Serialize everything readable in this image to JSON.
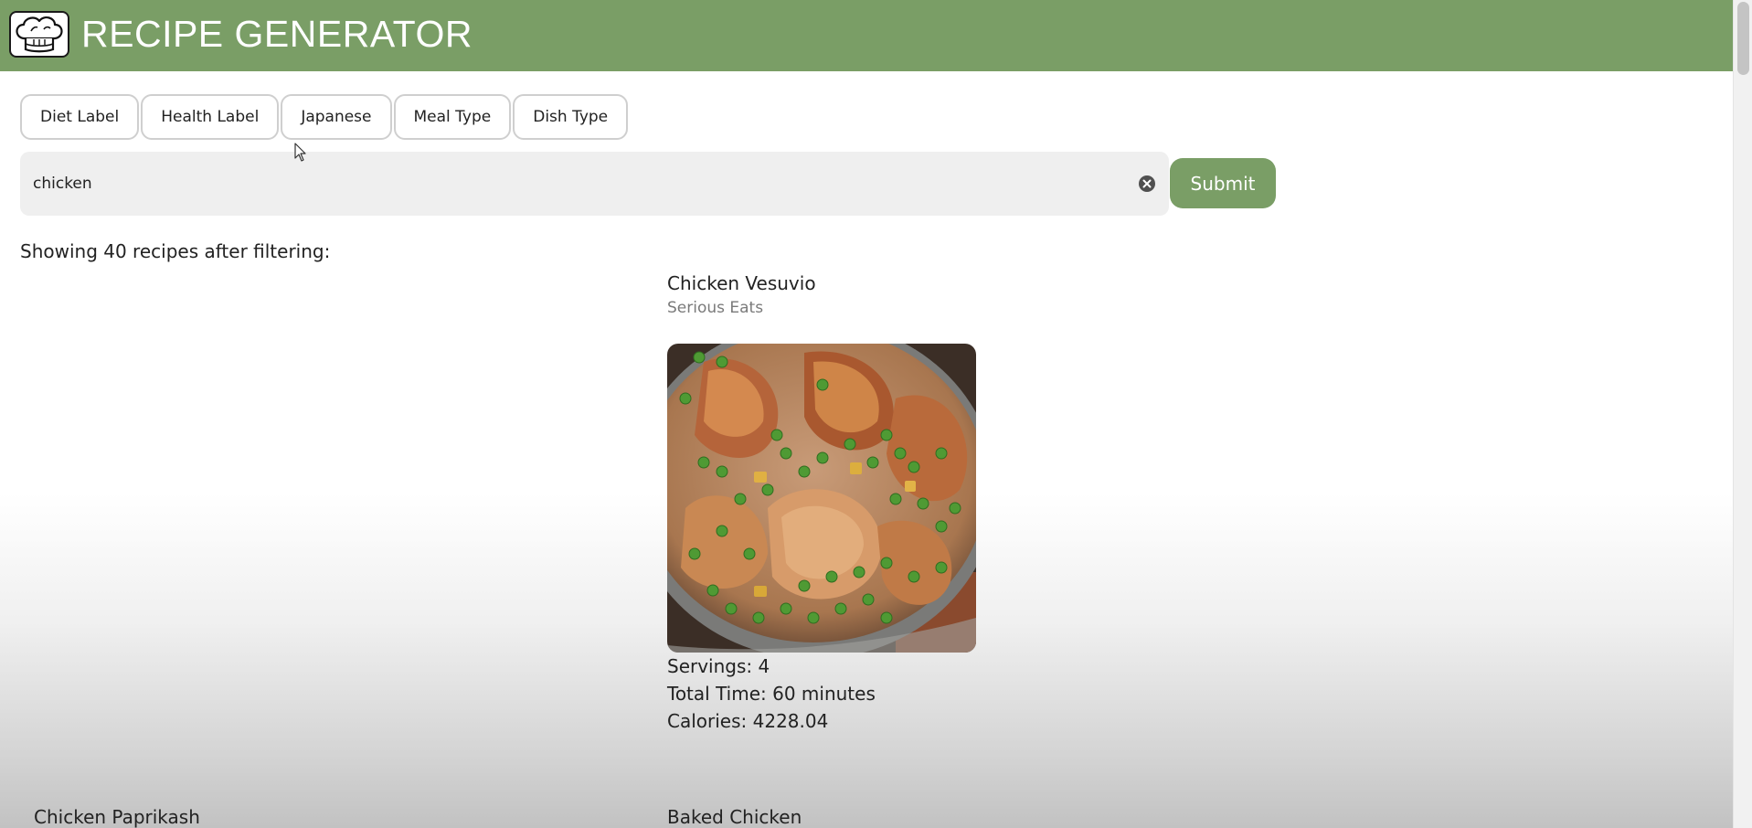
{
  "header": {
    "title": "RECIPE GENERATOR",
    "logo_icon": "chef-hat-icon",
    "background_color": "#7a9e66"
  },
  "filters": [
    {
      "label": "Diet Label"
    },
    {
      "label": "Health Label"
    },
    {
      "label": "Japanese"
    },
    {
      "label": "Meal Type"
    },
    {
      "label": "Dish Type"
    }
  ],
  "search": {
    "value": "chicken",
    "clear_icon": "clear-circle-icon"
  },
  "submit": {
    "label": "Submit",
    "color": "#7a9e66"
  },
  "results": {
    "count_text": "Showing 40 recipes after filtering:"
  },
  "recipes": [
    {
      "title": "Chicken Vesuvio",
      "source": "Serious Eats",
      "servings": "Servings: 4",
      "total_time": "Total Time: 60 minutes",
      "calories": "Calories: 4228.04"
    },
    {
      "title": "Chicken Paprikash"
    },
    {
      "title": "Baked Chicken"
    }
  ]
}
